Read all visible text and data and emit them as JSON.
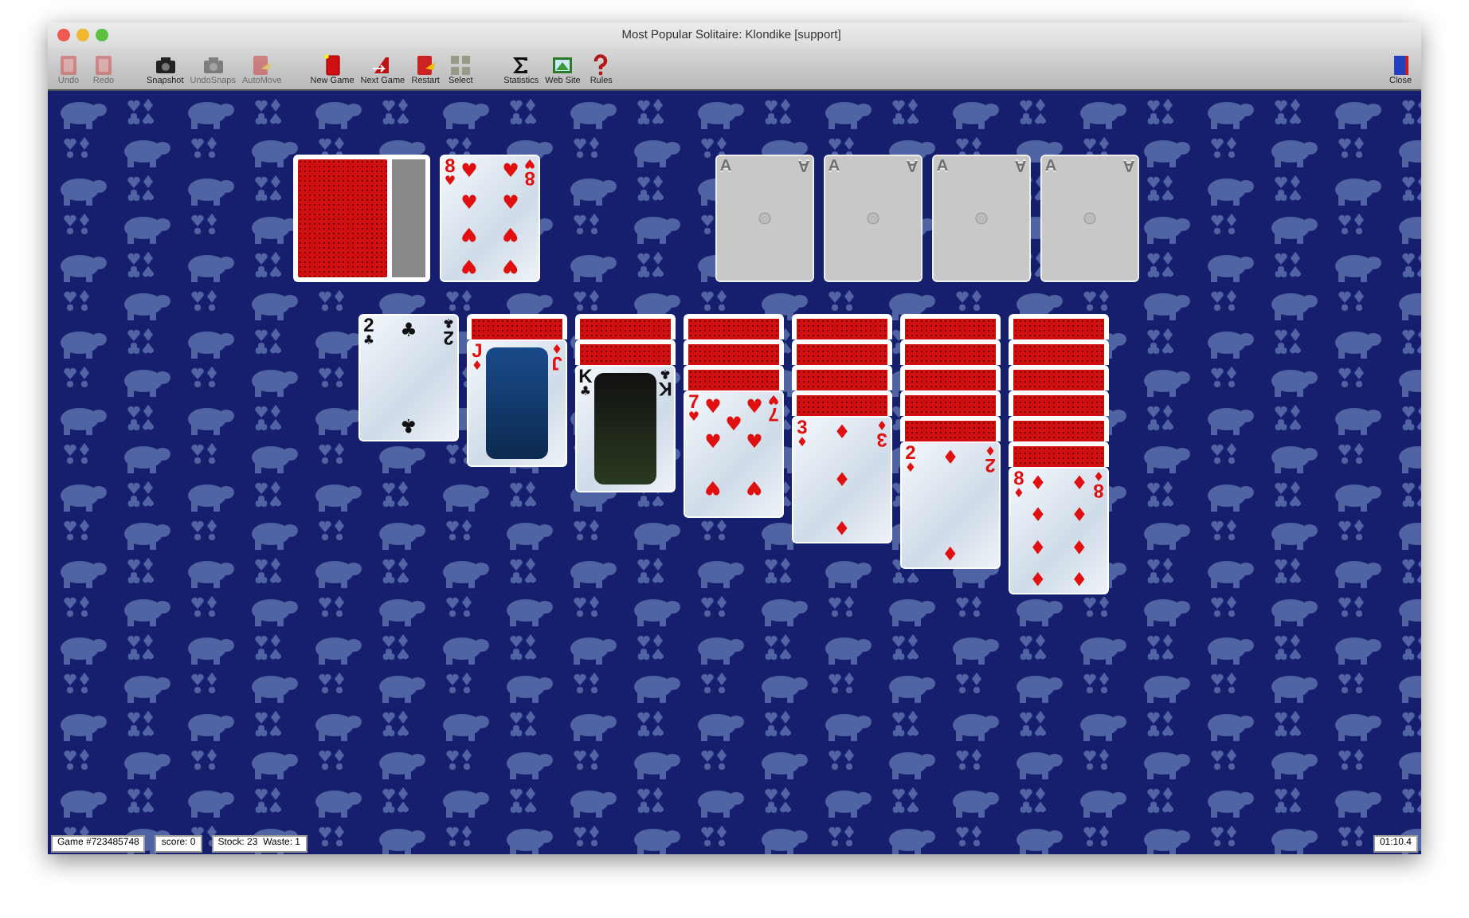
{
  "window": {
    "title": "Most Popular Solitaire: Klondike [support]"
  },
  "toolbar": {
    "groups": [
      [
        {
          "label": "Undo",
          "kind": "card-back",
          "disabled": true
        },
        {
          "label": "Redo",
          "kind": "card-back",
          "disabled": true
        }
      ],
      [
        {
          "label": "Snapshot",
          "kind": "camera",
          "disabled": false
        },
        {
          "label": "UndoSnaps",
          "kind": "camera",
          "disabled": true
        },
        {
          "label": "AutoMove",
          "kind": "card-arrow",
          "disabled": true
        }
      ],
      [
        {
          "label": "New Game",
          "kind": "card-red",
          "disabled": false
        },
        {
          "label": "Next Game",
          "kind": "card-next",
          "disabled": false
        },
        {
          "label": "Restart",
          "kind": "card-arrow",
          "disabled": false
        },
        {
          "label": "Select",
          "kind": "cards-grid",
          "disabled": false
        }
      ],
      [
        {
          "label": "Statistics",
          "kind": "sigma",
          "disabled": false
        },
        {
          "label": "Web Site",
          "kind": "picture",
          "disabled": false
        },
        {
          "label": "Rules",
          "kind": "question",
          "disabled": false
        }
      ]
    ],
    "close": {
      "label": "Close",
      "kind": "door",
      "disabled": false
    }
  },
  "stock": {
    "has_cards": true
  },
  "waste": {
    "kind": "eight",
    "color": "#e01010",
    "top_rank": "8",
    "top_suit": "♥",
    "pips": [
      "♥",
      "♥",
      "♥",
      "♥",
      "♥",
      "♥",
      "♥",
      "♥"
    ],
    "bottom_rank": "8",
    "bottom_suit": "♥"
  },
  "foundations": [
    {
      "top_label": "A",
      "bottom_label": "A"
    },
    {
      "top_label": "A",
      "bottom_label": "A"
    },
    {
      "top_label": "A",
      "bottom_label": "A"
    },
    {
      "top_label": "A",
      "bottom_label": "A"
    }
  ],
  "tableau": [
    {
      "cards": [
        {
          "face_up": true,
          "kind": "two",
          "color": "#111111",
          "top_rank": "2",
          "top_suit": "♣",
          "pips": [
            "♣",
            "♣"
          ],
          "bottom_rank": "2",
          "bottom_suit": "♣"
        }
      ]
    },
    {
      "cards": [
        {
          "face_up": false
        },
        {
          "face_up": true,
          "kind": "photo",
          "color": "#e01010",
          "top_rank": "J",
          "top_suit": "♦",
          "bottom_rank": "J",
          "bottom_suit": "♦"
        }
      ]
    },
    {
      "cards": [
        {
          "face_up": false
        },
        {
          "face_up": false
        },
        {
          "face_up": true,
          "kind": "photo",
          "color": "#111111",
          "top_rank": "K",
          "top_suit": "♣",
          "bottom_rank": "K",
          "bottom_suit": "♣"
        }
      ]
    },
    {
      "cards": [
        {
          "face_up": false
        },
        {
          "face_up": false
        },
        {
          "face_up": false
        },
        {
          "face_up": true,
          "kind": "seven",
          "color": "#e01010",
          "top_rank": "7",
          "top_suit": "♥",
          "pips": [
            "♥",
            "♥",
            "♥",
            "♥",
            "♥",
            "♥",
            "♥"
          ],
          "bottom_rank": "7",
          "bottom_suit": "♥"
        }
      ]
    },
    {
      "cards": [
        {
          "face_up": false
        },
        {
          "face_up": false
        },
        {
          "face_up": false
        },
        {
          "face_up": false
        },
        {
          "face_up": true,
          "kind": "three",
          "color": "#e01010",
          "top_rank": "3",
          "top_suit": "♦",
          "pips": [
            "♦",
            "♦",
            "♦"
          ],
          "bottom_rank": "3",
          "bottom_suit": "♦"
        }
      ]
    },
    {
      "cards": [
        {
          "face_up": false
        },
        {
          "face_up": false
        },
        {
          "face_up": false
        },
        {
          "face_up": false
        },
        {
          "face_up": false
        },
        {
          "face_up": true,
          "kind": "two",
          "color": "#e01010",
          "top_rank": "2",
          "top_suit": "♦",
          "pips": [
            "♦",
            "♦"
          ],
          "bottom_rank": "2",
          "bottom_suit": "♦"
        }
      ]
    },
    {
      "cards": [
        {
          "face_up": false
        },
        {
          "face_up": false
        },
        {
          "face_up": false
        },
        {
          "face_up": false
        },
        {
          "face_up": false
        },
        {
          "face_up": false
        },
        {
          "face_up": true,
          "kind": "eight",
          "color": "#e01010",
          "top_rank": "8",
          "top_suit": "♦",
          "pips": [
            "♦",
            "♦",
            "♦",
            "♦",
            "♦",
            "♦",
            "♦",
            "♦"
          ],
          "bottom_rank": "8",
          "bottom_suit": "♦"
        }
      ]
    }
  ],
  "status_bar": {
    "game": "Game #723485748",
    "score": "score: 0",
    "stock_waste": "Stock: 23  Waste: 1",
    "time": "01:10.4"
  }
}
